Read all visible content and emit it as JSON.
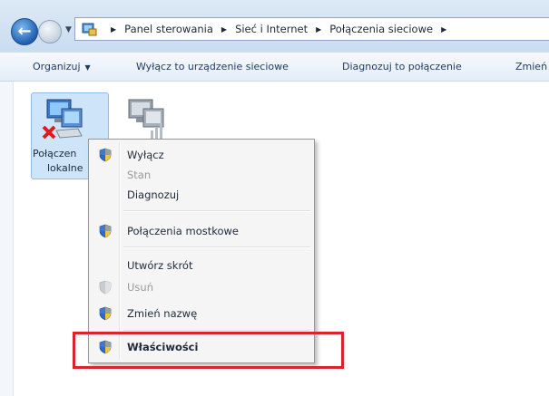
{
  "address_bar": {
    "breadcrumbs": [
      "Panel sterowania",
      "Sieć i Internet",
      "Połączenia sieciowe"
    ],
    "separator_icon": "chevron-right-icon"
  },
  "toolbar": {
    "organize_label": "Organizuj",
    "disable_device_label": "Wyłącz to urządzenie sieciowe",
    "diagnose_label": "Diagnozuj to połączenie",
    "rename_label": "Zmień"
  },
  "connections": [
    {
      "label_line1": "Połączen",
      "label_line2": "lokalne",
      "selected": true
    },
    {
      "label_line1": "",
      "label_line2": "",
      "selected": false
    }
  ],
  "context_menu": {
    "items": [
      {
        "label": "Wyłącz",
        "shield": true,
        "disabled": false
      },
      {
        "label": "Stan",
        "shield": false,
        "disabled": true
      },
      {
        "label": "Diagnozuj",
        "shield": false,
        "disabled": false
      },
      {
        "label": "Połączenia mostkowe",
        "shield": true,
        "disabled": false
      },
      {
        "label": "Utwórz skrót",
        "shield": false,
        "disabled": false
      },
      {
        "label": "Usuń",
        "shield": true,
        "disabled": true
      },
      {
        "label": "Zmień nazwę",
        "shield": true,
        "disabled": false
      },
      {
        "label": "Właściwości",
        "shield": true,
        "disabled": false,
        "bold": true
      }
    ]
  },
  "colors": {
    "highlight": "#d9232e",
    "selection": "#cde4f9",
    "menu_background": "#f5f5f5"
  }
}
